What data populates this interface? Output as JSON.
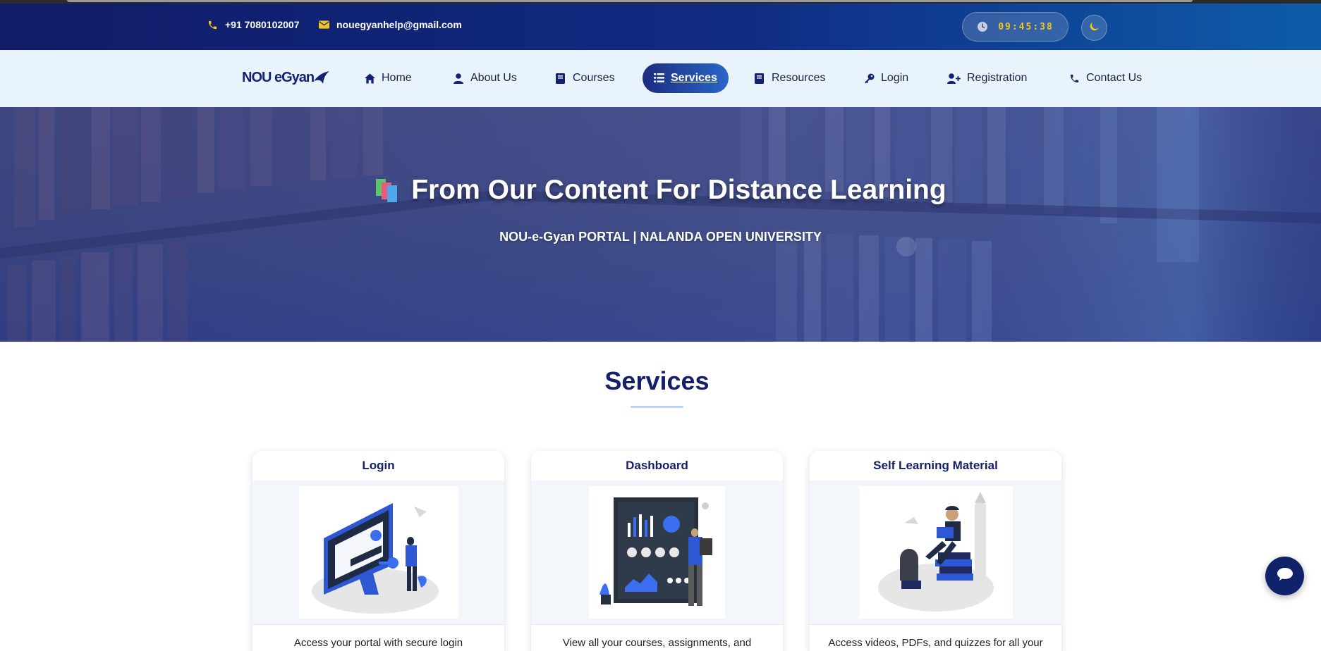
{
  "topbar": {
    "phone": "+91 7080102007",
    "email": "nouegyanhelp@gmail.com",
    "clock_time": "09:45:38",
    "theme_icon": "moon-icon"
  },
  "nav": {
    "logo_text": "NOU eGyan",
    "items": [
      {
        "label": "Home",
        "icon": "home-icon"
      },
      {
        "label": "About Us",
        "icon": "user-icon"
      },
      {
        "label": "Courses",
        "icon": "book-icon"
      },
      {
        "label": "Services",
        "icon": "list-icon",
        "active": true
      },
      {
        "label": "Resources",
        "icon": "book-icon"
      },
      {
        "label": "Login",
        "icon": "key-icon"
      },
      {
        "label": "Registration",
        "icon": "user-plus-icon"
      },
      {
        "label": "Contact Us",
        "icon": "phone-icon"
      }
    ]
  },
  "hero": {
    "title": "From Our Content For Distance Learning",
    "subtitle": "NOU-e-Gyan PORTAL | NALANDA OPEN UNIVERSITY"
  },
  "services": {
    "heading": "Services",
    "cards": [
      {
        "title": "Login",
        "description": "Access your portal with secure login"
      },
      {
        "title": "Dashboard",
        "description": "View all your courses, assignments, and"
      },
      {
        "title": "Self Learning Material",
        "description": "Access videos, PDFs, and quizzes for all your"
      }
    ]
  },
  "colors": {
    "topbar_start": "#111b67",
    "topbar_end": "#0d5ca8",
    "nav_bg": "#e9f3fc",
    "accent_yellow": "#f3c31f",
    "heading_navy": "#14206a"
  }
}
